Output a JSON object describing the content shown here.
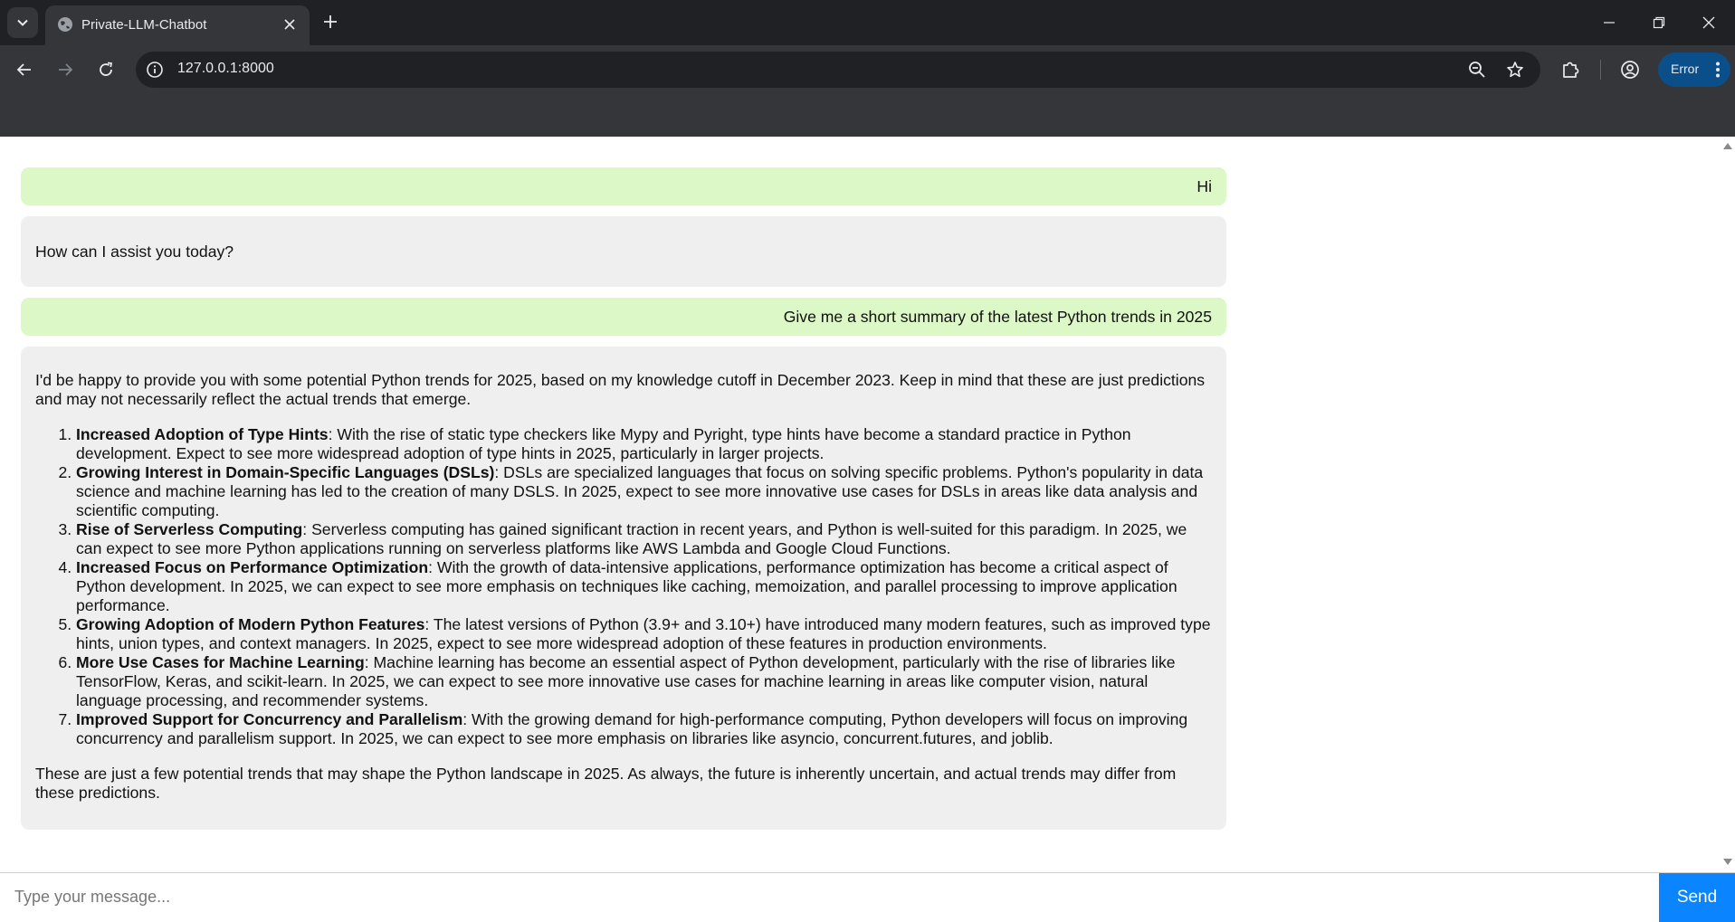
{
  "browser": {
    "tab_title": "Private-LLM-Chatbot",
    "url": "127.0.0.1:8000",
    "profile_status": "Error"
  },
  "chat": {
    "messages": [
      {
        "role": "user",
        "text": "Hi"
      },
      {
        "role": "bot",
        "text": "How can I assist you today?"
      },
      {
        "role": "user",
        "text": "Give me a short summary of the latest Python trends in 2025"
      },
      {
        "role": "bot",
        "intro": "I'd be happy to provide you with some potential Python trends for 2025, based on my knowledge cutoff in December 2023. Keep in mind that these are just predictions and may not necessarily reflect the actual trends that emerge.",
        "items": [
          {
            "title": "Increased Adoption of Type Hints",
            "text": ": With the rise of static type checkers like Mypy and Pyright, type hints have become a standard practice in Python development. Expect to see more widespread adoption of type hints in 2025, particularly in larger projects."
          },
          {
            "title": "Growing Interest in Domain-Specific Languages (DSLs)",
            "text": ": DSLs are specialized languages that focus on solving specific problems. Python's popularity in data science and machine learning has led to the creation of many DSLS. In 2025, expect to see more innovative use cases for DSLs in areas like data analysis and scientific computing."
          },
          {
            "title": "Rise of Serverless Computing",
            "text": ": Serverless computing has gained significant traction in recent years, and Python is well-suited for this paradigm. In 2025, we can expect to see more Python applications running on serverless platforms like AWS Lambda and Google Cloud Functions."
          },
          {
            "title": "Increased Focus on Performance Optimization",
            "text": ": With the growth of data-intensive applications, performance optimization has become a critical aspect of Python development. In 2025, we can expect to see more emphasis on techniques like caching, memoization, and parallel processing to improve application performance."
          },
          {
            "title": "Growing Adoption of Modern Python Features",
            "text": ": The latest versions of Python (3.9+ and 3.10+) have introduced many modern features, such as improved type hints, union types, and context managers. In 2025, expect to see more widespread adoption of these features in production environments."
          },
          {
            "title": "More Use Cases for Machine Learning",
            "text": ": Machine learning has become an essential aspect of Python development, particularly with the rise of libraries like TensorFlow, Keras, and scikit-learn. In 2025, we can expect to see more innovative use cases for machine learning in areas like computer vision, natural language processing, and recommender systems."
          },
          {
            "title": "Improved Support for Concurrency and Parallelism",
            "text": ": With the growing demand for high-performance computing, Python developers will focus on improving concurrency and parallelism support. In 2025, we can expect to see more emphasis on libraries like asyncio, concurrent.futures, and joblib."
          }
        ],
        "outro": "These are just a few potential trends that may shape the Python landscape in 2025. As always, the future is inherently uncertain, and actual trends may differ from these predictions."
      }
    ]
  },
  "composer": {
    "placeholder": "Type your message...",
    "send_label": "Send"
  },
  "colors": {
    "user_bubble": "#dcf8c6",
    "bot_bubble": "#efefef",
    "send_button": "#0a84ff",
    "profile_button": "#0b4f8a"
  }
}
